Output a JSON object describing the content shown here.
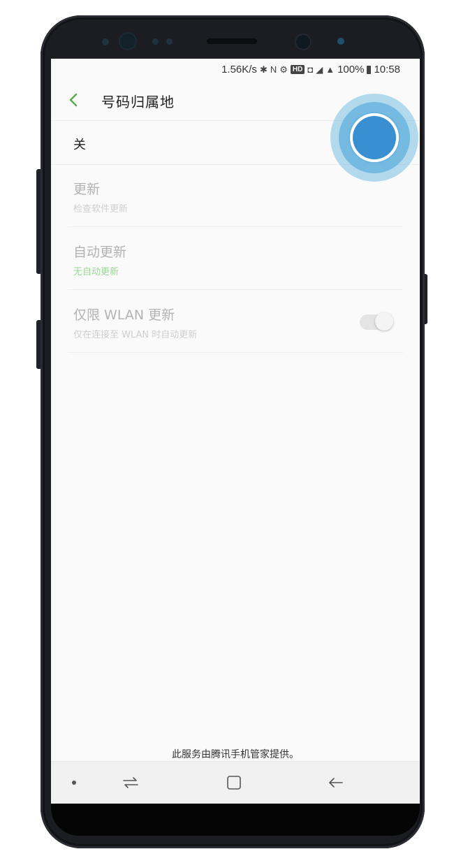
{
  "statusbar": {
    "net_speed": "1.56K/s",
    "hd_badge": "HD",
    "battery": "100%",
    "time": "10:58"
  },
  "header": {
    "title": "号码归属地"
  },
  "master_switch": {
    "label": "关"
  },
  "settings": [
    {
      "title": "更新",
      "subtitle": "检查软件更新"
    },
    {
      "title": "自动更新",
      "subtitle": "无自动更新"
    },
    {
      "title": "仅限 WLAN 更新",
      "subtitle": "仅在连接至 WLAN 时自动更新"
    }
  ],
  "footer": {
    "note": "此服务由腾讯手机管家提供。"
  },
  "colors": {
    "accent_green": "#5aaa4a",
    "touch_blue": "#3a8fd3"
  },
  "icons": {
    "back": "chevron-left-icon",
    "recent": "recent-apps-icon",
    "home": "home-icon",
    "nav_back": "back-arrow-icon"
  }
}
